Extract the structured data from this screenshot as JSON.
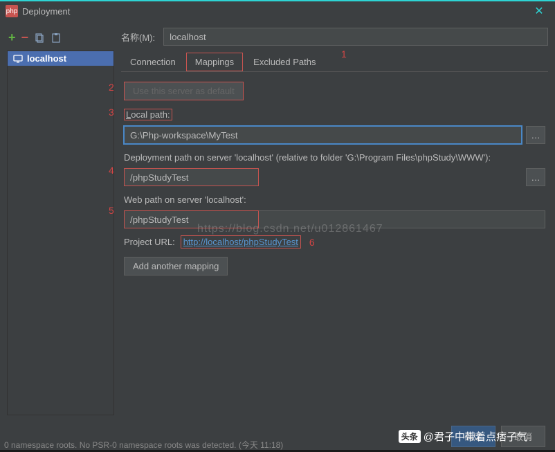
{
  "window": {
    "title": "Deployment",
    "icon_label": "php"
  },
  "toolbar": {
    "add": "+",
    "remove": "−"
  },
  "sidebar": {
    "servers": [
      {
        "name": "localhost"
      }
    ]
  },
  "form": {
    "name_label": "名称(M):",
    "name_value": "localhost",
    "tabs": [
      "Connection",
      "Mappings",
      "Excluded Paths"
    ],
    "active_tab": "Mappings",
    "use_default_btn": "Use this server as default",
    "local_path_label": "Local path:",
    "local_path_value": "G:\\Php-workspace\\MyTest",
    "deploy_path_label": "Deployment path on server 'localhost' (relative to folder 'G:\\Program Files\\phpStudy\\WWW'):",
    "deploy_path_value": "/phpStudyTest",
    "web_path_label": "Web path on server 'localhost':",
    "web_path_value": "/phpStudyTest",
    "project_url_label": "Project URL:",
    "project_url_value": "http://localhost/phpStudyTest",
    "add_mapping_btn": "Add another mapping"
  },
  "annotations": {
    "a1": "1",
    "a2": "2",
    "a3": "3",
    "a4": "4",
    "a5": "5",
    "a6": "6"
  },
  "watermark": "https://blog.csdn.net/u012861467",
  "footer": {
    "ok": "确定",
    "cancel": "取消"
  },
  "attribution": {
    "logo": "头条",
    "handle": "@君子中带着点痞子气"
  },
  "statusbar": "0 namespace roots. No PSR-0 namespace roots was detected. (今天 11:18)"
}
